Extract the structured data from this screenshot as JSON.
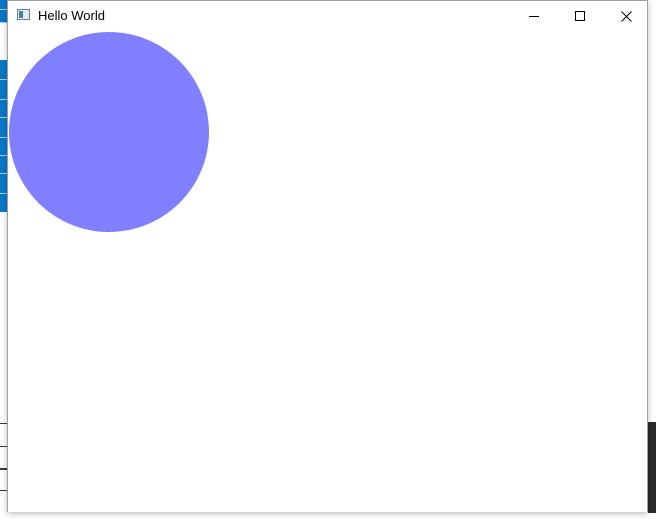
{
  "window": {
    "title": "Hello World",
    "icon": "window-app-icon",
    "controls": {
      "minimize_icon": "minimize-icon",
      "maximize_icon": "maximize-icon",
      "close_icon": "close-icon"
    }
  },
  "canvas": {
    "shape": "circle",
    "fill_color": "#8080ff"
  },
  "colors": {
    "background_app_blue": "#0a78c8",
    "window_background": "#ffffff"
  }
}
